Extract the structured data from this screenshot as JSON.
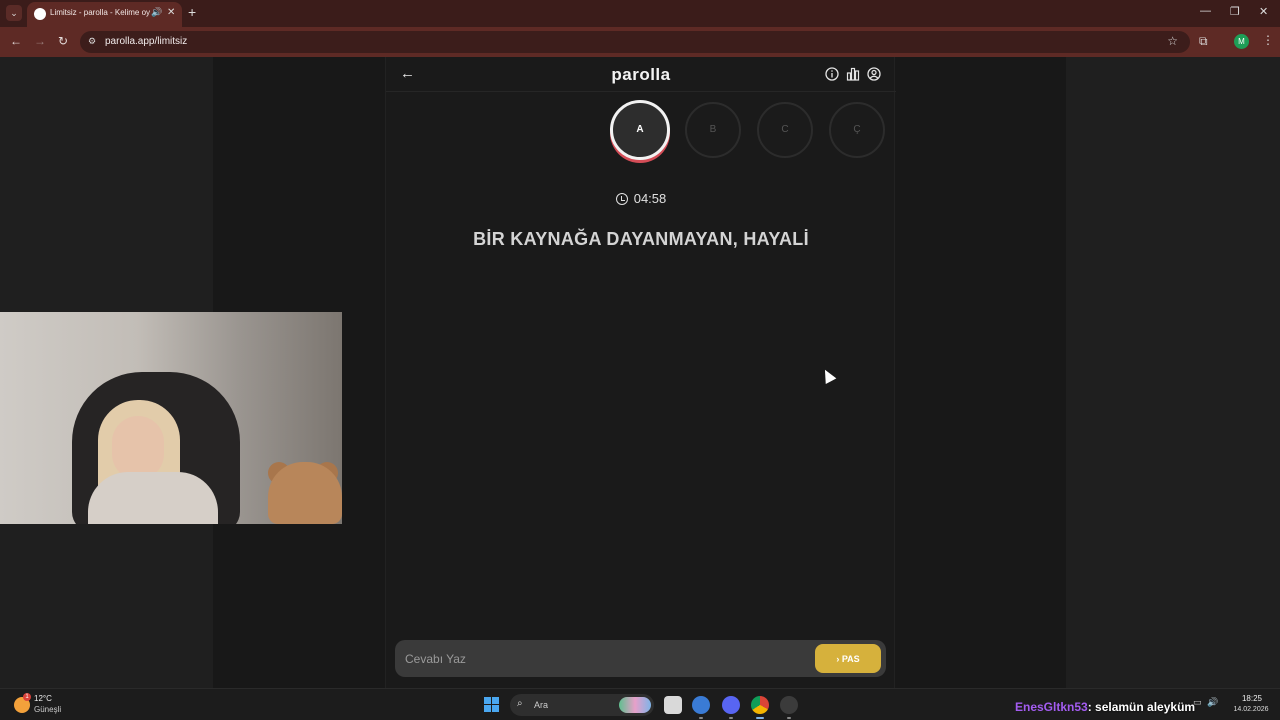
{
  "browser": {
    "tab_title": "Limitsiz - parolla - Kelime oyunu",
    "url": "parolla.app/limitsiz",
    "profile_initial": "M"
  },
  "app": {
    "logo": "parolla",
    "letters": [
      {
        "label": "A",
        "state": "active"
      },
      {
        "label": "B",
        "state": "pending"
      },
      {
        "label": "C",
        "state": "pending"
      },
      {
        "label": "Ç",
        "state": "pending"
      }
    ],
    "timer": "04:58",
    "question": "BİR KAYNAĞA DAYANMAYAN, HAYALİ",
    "answer_placeholder": "Cevabı Yaz",
    "pass_label": "PAS",
    "colors": {
      "accent": "#d6b13c",
      "active_ring": "#d44d57"
    }
  },
  "taskbar": {
    "weather_temp": "12°C",
    "weather_condition": "Güneşli",
    "search_placeholder": "Ara",
    "time": "18:25",
    "date": "14.02.2026"
  },
  "stream_chat": {
    "user": "EnesGltkn53",
    "message": ": selamün aleyküm"
  }
}
